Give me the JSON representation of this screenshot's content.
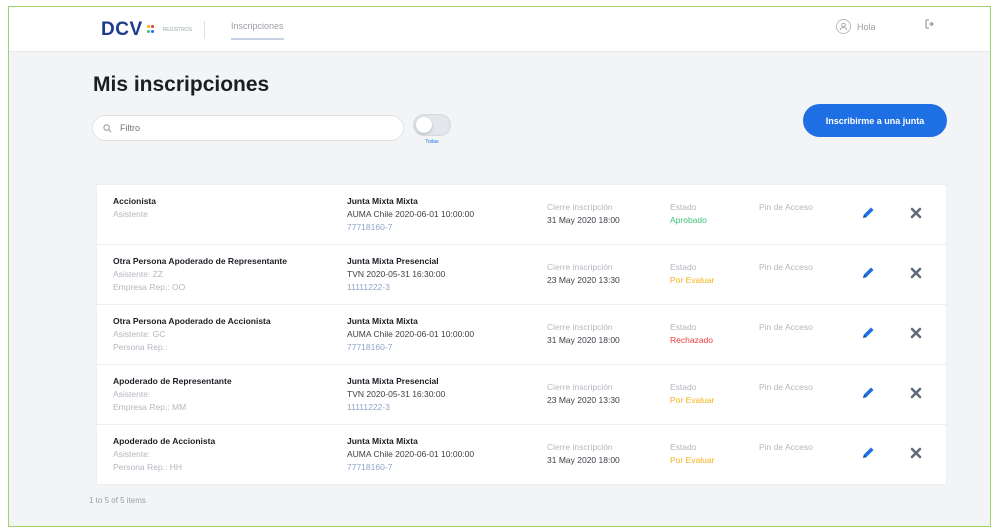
{
  "header": {
    "logo": "DCV",
    "logo_sub": "REGISTROS",
    "nav_tab": "Inscripciones",
    "user_name": "Hola",
    "logout_icon": "logout-icon"
  },
  "page": {
    "title": "Mis inscripciones",
    "search_placeholder": "Filtro",
    "toggle_label": "Todas",
    "cta_label": "Inscribirme a una junta"
  },
  "labels": {
    "cierre": "Cierre inscripción",
    "estado": "Estado",
    "pin": "Pin de Acceso"
  },
  "rows": [
    {
      "name": "Accionista",
      "sub1": "Asistente",
      "sub2": "",
      "junta": "Junta Mixta Mixta",
      "junta_detail": "AUMA Chile 2020-06-01 10:00:00",
      "rut": "77718160-7",
      "cierre_date": "31 May 2020 18:00",
      "estado": "Aprobado",
      "estado_class": "st-aprobado"
    },
    {
      "name": "Otra Persona Apoderado de Representante",
      "sub1": "Asistente: ZZ",
      "sub2": "Empresa Rep.: OO",
      "junta": "Junta Mixta Presencial",
      "junta_detail": "TVN 2020-05-31 16:30:00",
      "rut": "11111222-3",
      "cierre_date": "23 May 2020 13:30",
      "estado": "Por Evaluar",
      "estado_class": "st-evaluar"
    },
    {
      "name": "Otra Persona Apoderado de Accionista",
      "sub1": "Asistente: GC",
      "sub2": "Persona Rep.:",
      "junta": "Junta Mixta Mixta",
      "junta_detail": "AUMA Chile 2020-06-01 10:00:00",
      "rut": "77718160-7",
      "cierre_date": "31 May 2020 18:00",
      "estado": "Rechazado",
      "estado_class": "st-rechazado"
    },
    {
      "name": "Apoderado de Representante",
      "sub1": "Asistente:",
      "sub2": "Empresa Rep.: MM",
      "junta": "Junta Mixta Presencial",
      "junta_detail": "TVN 2020-05-31 16:30:00",
      "rut": "11111222-3",
      "cierre_date": "23 May 2020 13:30",
      "estado": "Por Evaluar",
      "estado_class": "st-evaluar"
    },
    {
      "name": "Apoderado de Accionista",
      "sub1": "Asistente:",
      "sub2": "Persona Rep.: HH",
      "junta": "Junta Mixta Mixta",
      "junta_detail": "AUMA Chile 2020-06-01 10:00:00",
      "rut": "77718160-7",
      "cierre_date": "31 May 2020 18:00",
      "estado": "Por Evaluar",
      "estado_class": "st-evaluar"
    }
  ],
  "footer": {
    "pagination": "1 to 5 of 5 items"
  },
  "colors": {
    "primary": "#1d6fe3",
    "aprobado": "#3ec27a",
    "por_evaluar": "#f3b21b",
    "rechazado": "#ee3b3b"
  },
  "icons": [
    "search-icon",
    "user-icon",
    "logout-icon",
    "pencil-icon",
    "close-icon"
  ]
}
